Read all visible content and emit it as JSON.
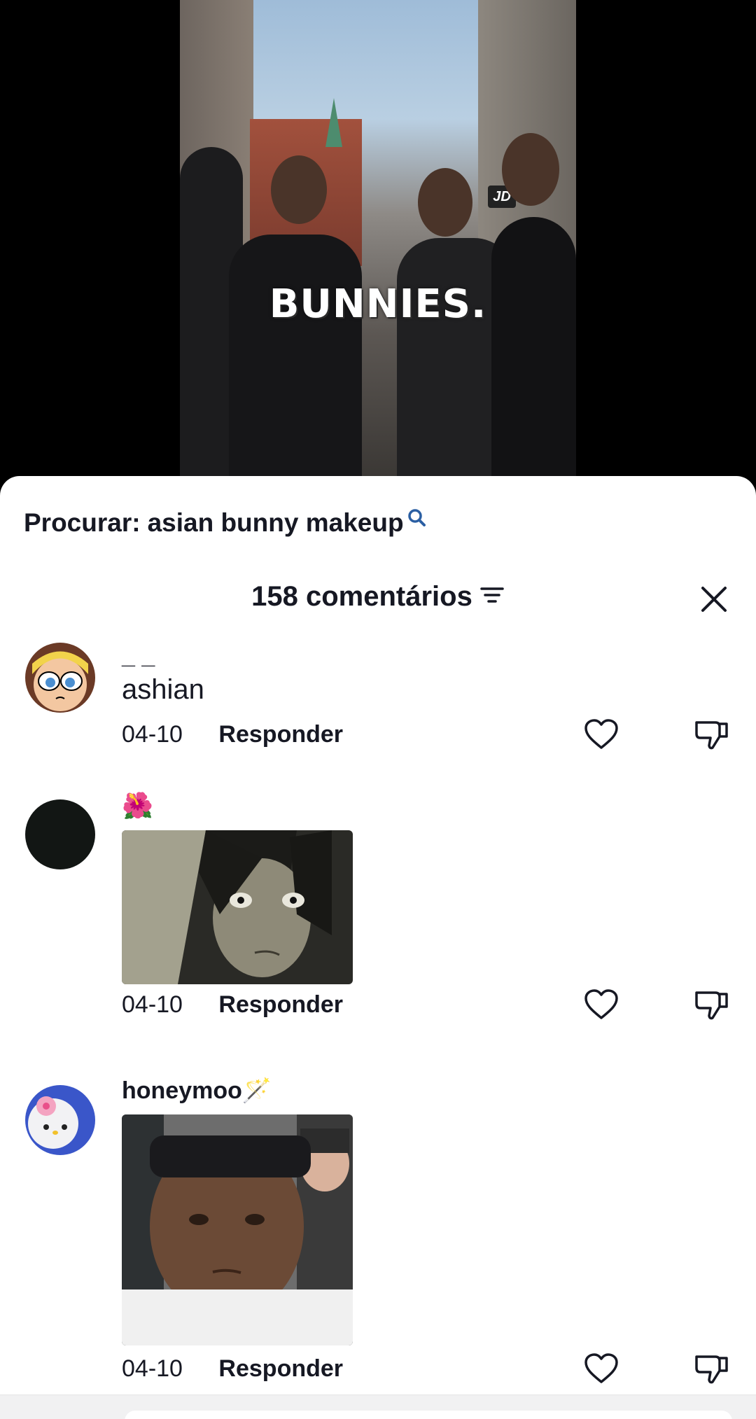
{
  "video": {
    "caption": "BUNNIES.",
    "store_sign": "JD"
  },
  "sheet": {
    "search_label": "Procurar:",
    "search_query": "asian bunny makeup",
    "comment_count_label": "158 comentários"
  },
  "comments": [
    {
      "username": "_ _",
      "text": "ashian",
      "date": "04-10",
      "reply_label": "Responder"
    },
    {
      "username": "🌺",
      "date": "04-10",
      "reply_label": "Responder"
    },
    {
      "username": "honeymoo🪄",
      "date": "04-10",
      "reply_label": "Responder"
    }
  ],
  "colors": {
    "text": "#161823",
    "search_icon": "#2b5fa3",
    "background": "#ffffff"
  }
}
